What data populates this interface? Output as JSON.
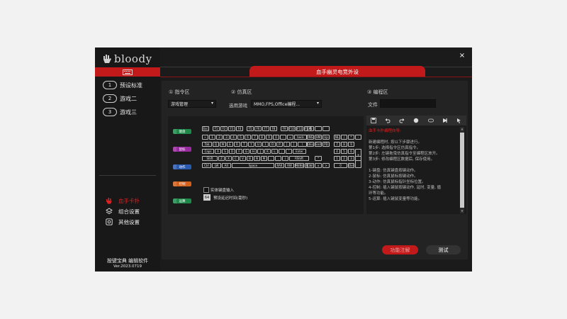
{
  "app": {
    "logo_text": "bloody",
    "close_glyph": "×",
    "title": "血手幽灵电竞外设",
    "brand_color": "#c21a1a"
  },
  "sidebar": {
    "keyboard_icon": "keyboard-icon",
    "modes": [
      {
        "num": "1",
        "label": "预设标准"
      },
      {
        "num": "2",
        "label": "游戏二"
      },
      {
        "num": "3",
        "label": "游戏三"
      }
    ],
    "bottom": [
      {
        "icon": "bloody-hand-icon",
        "label": "血手卡扑",
        "color": "#e02020"
      },
      {
        "icon": "layers-icon",
        "label": "组合设置",
        "color": "#e6e6e6"
      },
      {
        "icon": "gear-icon",
        "label": "其他设置",
        "color": "#e6e6e6"
      }
    ],
    "footer_line1": "按键宝典 编辑软件",
    "footer_line2": "Ver.2023.0719"
  },
  "sections": {
    "cmd_label": "① 指令区",
    "sim_label": "② 仿真区",
    "edit_label": "③ 编程区",
    "game_select": "游戏管理",
    "sim_prefix": "选用游戏",
    "sim_select": "MMO,FPS,Office编程...",
    "file_label": "文件"
  },
  "categories": [
    {
      "label": "键盘",
      "color": "#1e8a4a"
    },
    {
      "label": "鼠标",
      "color": "#9a2aa0"
    },
    {
      "label": "动作",
      "color": "#2a5ab0"
    },
    {
      "label": "控制",
      "color": "#d2601a"
    },
    {
      "label": "运算",
      "color": "#1e8a4a"
    }
  ],
  "keyboard_rows": [
    [
      "Esc",
      "",
      "F1",
      "F2",
      "F3",
      "F4",
      "",
      "F5",
      "F6",
      "F7",
      "F8",
      "",
      "F9",
      "F10",
      "F11",
      "F12"
    ],
    [
      "~",
      "1",
      "2",
      "3",
      "4",
      "5",
      "6",
      "7",
      "8",
      "9",
      "0",
      "-",
      "=",
      "back"
    ],
    [
      "Tab",
      "Q",
      "W",
      "E",
      "R",
      "T",
      "Y",
      "U",
      "I",
      "O",
      "P",
      "[",
      "]",
      "\\"
    ],
    [
      "Caps",
      "A",
      "S",
      "D",
      "F",
      "G",
      "H",
      "J",
      "K",
      "L",
      ";",
      "'",
      "Enter"
    ],
    [
      "Shift",
      "Z",
      "X",
      "C",
      "V",
      "B",
      "N",
      "M",
      ",",
      ".",
      "/",
      "RShift"
    ],
    [
      "Ctrl",
      "LW",
      "Alt",
      "Space",
      "RAlt",
      "RW",
      "MENU",
      "RCtrl"
    ]
  ],
  "nav_rows": [
    [
      "PS",
      "",
      ""
    ],
    [
      "INS",
      "HM",
      "Up"
    ],
    [
      "DEL",
      "End",
      "PD"
    ],
    [
      "",
      "",
      ""
    ],
    [
      "",
      "^",
      ""
    ],
    [
      "<",
      "v",
      ">"
    ]
  ],
  "numpad_rows": [
    [
      "NL",
      "/",
      "*",
      "-"
    ],
    [
      "7",
      "8",
      "9",
      ""
    ],
    [
      "4",
      "5",
      "6",
      "+"
    ],
    [
      "1",
      "2",
      "3",
      ""
    ],
    [
      "0",
      "",
      "Del",
      ""
    ]
  ],
  "kb_options": {
    "physical": "实体键盘输入",
    "delay_value": "64",
    "delay_label": "预设延迟时间(毫秒)"
  },
  "editor": {
    "toolbar_icons": [
      "save-icon",
      "undo-icon",
      "redo-icon",
      "record-icon",
      "loop-icon",
      "play-icon",
      "cursor-icon"
    ],
    "heading": "血手卡扑编程向导:",
    "lines": [
      "新建编程时, 按以下步骤进行。",
      "第1步: 选择指令区仿真指令。",
      "第2步: 左键拖曳仿真指令至编程区放开。",
      "第3步: 修改编程区数据后, 保存使用。",
      "",
      "1-键盘: 仿真键盘按键动作。",
      "2-鼠标: 仿真鼠标按键动作。",
      "3-动作: 仿真鼠标指针坐标位置。",
      "4-控制: 插入键鼠按键动作, 延时, 变量, 循",
      "环等功能。",
      "5-运算: 插入键鼠变量等功能。"
    ]
  },
  "buttons": {
    "register": "功能注解",
    "test": "测试"
  }
}
